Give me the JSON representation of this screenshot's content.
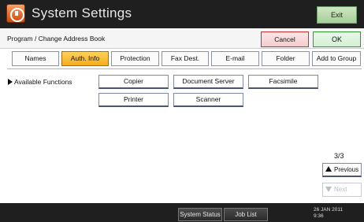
{
  "titlebar": {
    "title": "System Settings",
    "icon": "system-settings-icon",
    "exit_label": "Exit"
  },
  "header": {
    "breadcrumb": "Program / Change Address Book",
    "cancel_label": "Cancel",
    "ok_label": "OK"
  },
  "tabs": [
    {
      "label": "Names",
      "active": false
    },
    {
      "label": "Auth. Info",
      "active": true
    },
    {
      "label": "Protection",
      "active": false
    },
    {
      "label": "Fax Dest.",
      "active": false
    },
    {
      "label": "E-mail",
      "active": false
    },
    {
      "label": "Folder",
      "active": false
    },
    {
      "label": "Add to Group",
      "active": false
    }
  ],
  "available_functions": {
    "label": "Available Functions",
    "items": [
      "Copier",
      "Document Server",
      "Facsimile",
      "Printer",
      "Scanner"
    ]
  },
  "paging": {
    "indicator": "3/3",
    "previous_label": "Previous",
    "next_label": "Next"
  },
  "bottombar": {
    "system_status_label": "System Status",
    "job_list_label": "Job List",
    "date": "26 JAN  2011",
    "time": "9:36"
  },
  "colors": {
    "active_tab": "#f4ad1c",
    "exit_button": "#a6cd98",
    "cancel_border": "#c8302f",
    "ok_border": "#2e9a2e",
    "bars": "#1f1f1f"
  }
}
